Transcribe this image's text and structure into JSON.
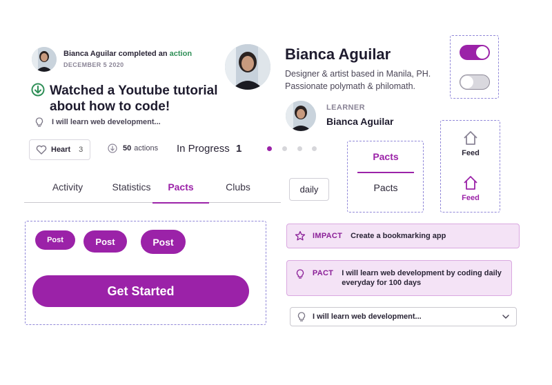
{
  "feed": {
    "user_name": "Bianca Aguilar",
    "completed_text": " completed an ",
    "action_word": "action",
    "date": "DECEMBER 5 2020",
    "title": "Watched a Youtube tutorial about how to code!",
    "pact_text": "I will learn web development..."
  },
  "reactions": {
    "heart_label": "Heart",
    "heart_count": "3",
    "actions_count": "50",
    "actions_label": "actions",
    "status": "In Progress",
    "status_count": "1"
  },
  "tabs": [
    "Activity",
    "Statistics",
    "Pacts",
    "Clubs"
  ],
  "buttons": {
    "post_small": "Post",
    "post_medium": "Post",
    "post_large": "Post",
    "get_started": "Get Started"
  },
  "profile": {
    "name": "Bianca Aguilar",
    "bio_line1": "Designer & artist based in Manila, PH.",
    "bio_line2": "Passionate polymath & philomath.",
    "role": "LEARNER",
    "learner_name": "Bianca Aguilar"
  },
  "toggles": {
    "on": true,
    "off": false
  },
  "pact_tabs": {
    "active": "Pacts",
    "inactive": "Pacts"
  },
  "nav_feed": {
    "inactive": "Feed",
    "active": "Feed"
  },
  "chip_daily": "daily",
  "impact_card": {
    "label": "IMPACT",
    "text": "Create a bookmarking app"
  },
  "pact_card": {
    "label": "PACT",
    "text": "I will learn web development by coding daily everyday for 100 days"
  },
  "select": {
    "value": "I will learn web development..."
  },
  "colors": {
    "accent": "#9b22a8",
    "accent_light": "#f4e3f6",
    "success": "#2f8f57",
    "dashed_border": "#8f86d8"
  }
}
